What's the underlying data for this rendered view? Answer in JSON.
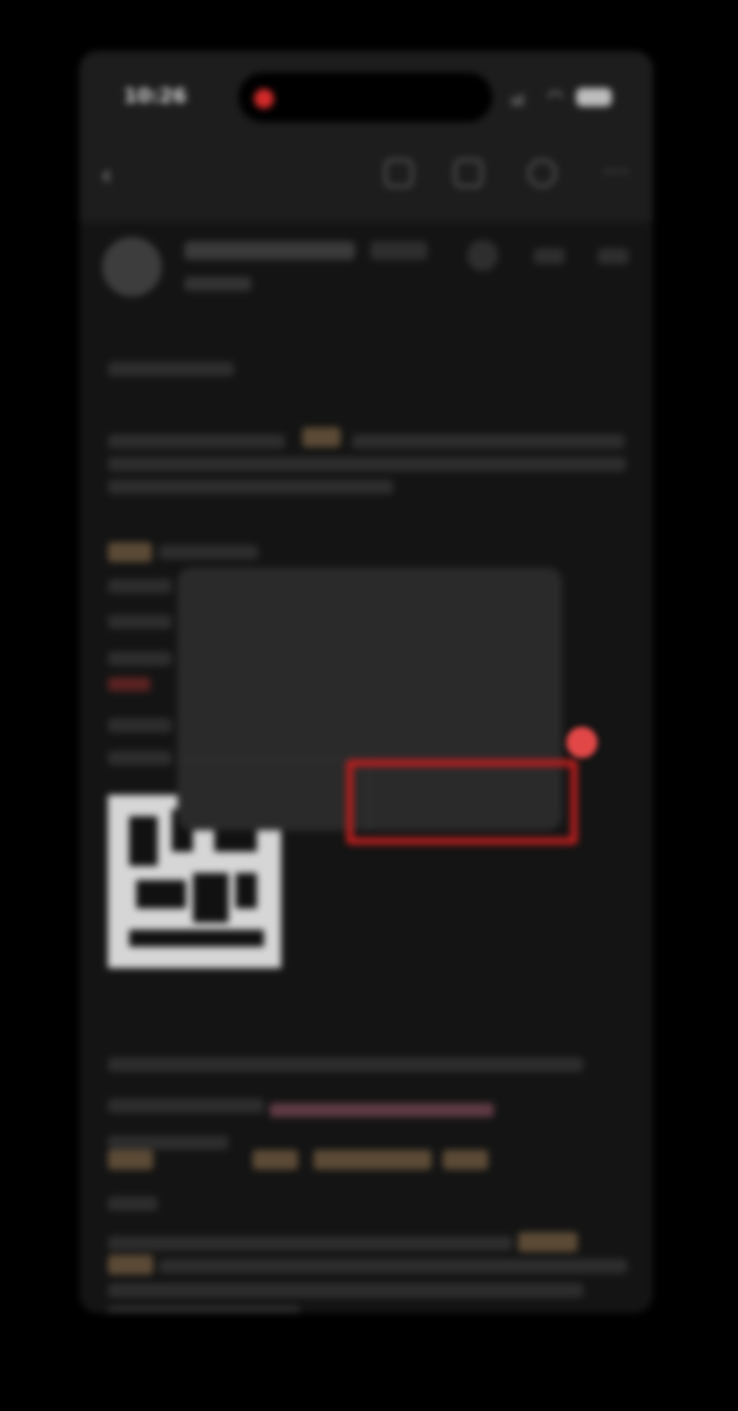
{
  "status_bar": {
    "time": "10:26",
    "signal": "ııl"
  },
  "dialog": {
    "title": "",
    "body_lines": [
      "",
      "",
      "",
      ""
    ],
    "cancel_label": "",
    "confirm_label": ""
  },
  "colors": {
    "background": "#000000",
    "screen": "#141414",
    "dialog_bg": "#2a2a2a",
    "dialog_button_text": "#4a86e8",
    "highlight_box": "#b81e1e",
    "marker_dot": "#e24747",
    "tag_highlight": "#5b4a35"
  },
  "icons": {
    "back": "chevron-left-icon",
    "toolbar": [
      "search-icon",
      "bookmark-icon",
      "share-icon",
      "more-icon"
    ],
    "wifi": "wifi-icon",
    "battery": "battery-icon"
  }
}
